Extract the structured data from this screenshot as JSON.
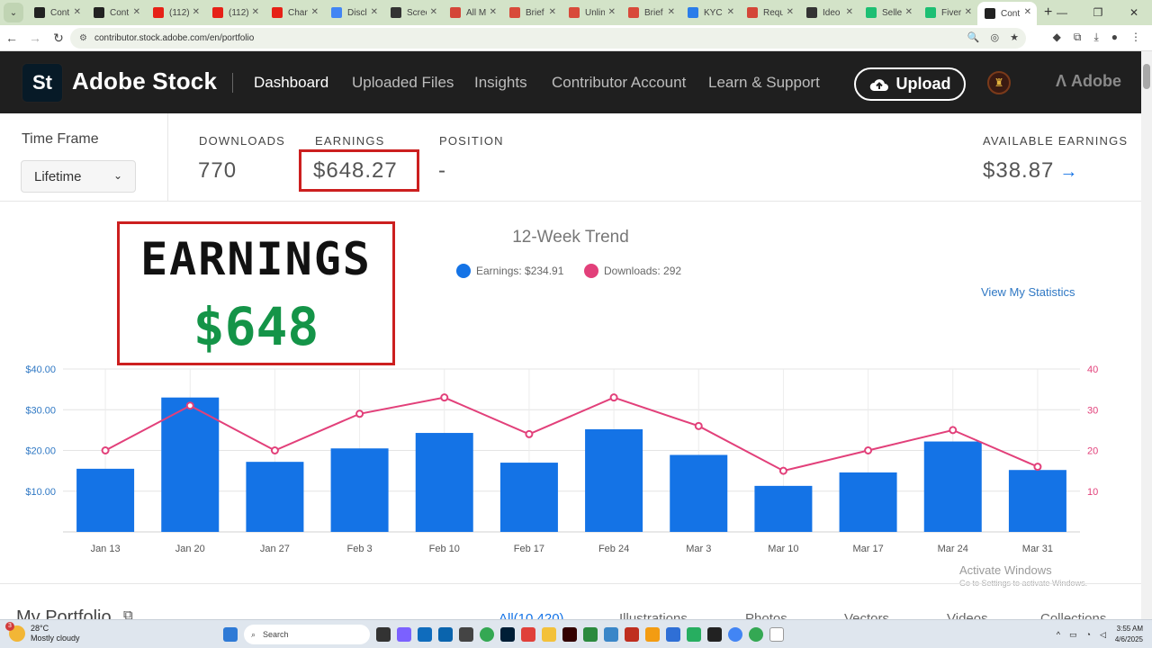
{
  "browser": {
    "tabs": [
      {
        "title": "Cont",
        "icon": "adobe-stock-icon",
        "color": "#222222"
      },
      {
        "title": "Cont",
        "icon": "adobe-stock-icon",
        "color": "#222222"
      },
      {
        "title": "(112)",
        "icon": "youtube-icon",
        "color": "#e62117"
      },
      {
        "title": "(112)",
        "icon": "youtube-icon",
        "color": "#e62117"
      },
      {
        "title": "Chan",
        "icon": "youtube-icon",
        "color": "#e62117"
      },
      {
        "title": "Discl",
        "icon": "google-icon",
        "color": "#4285f4"
      },
      {
        "title": "Scree",
        "icon": "circle-icon",
        "color": "#333333"
      },
      {
        "title": "All M",
        "icon": "gmail-icon",
        "color": "#d44638"
      },
      {
        "title": "Brief",
        "icon": "wd-icon",
        "color": "#d84a3a"
      },
      {
        "title": "Unlin",
        "icon": "wd-icon",
        "color": "#d84a3a"
      },
      {
        "title": "Brief",
        "icon": "wd-icon",
        "color": "#d84a3a"
      },
      {
        "title": "KYC",
        "icon": "check-icon",
        "color": "#2b7de9"
      },
      {
        "title": "Requ",
        "icon": "gmail-icon",
        "color": "#d44638"
      },
      {
        "title": "Ideo",
        "icon": "circle-icon",
        "color": "#333333"
      },
      {
        "title": "Selle",
        "icon": "fiverr-icon",
        "color": "#1dbf73"
      },
      {
        "title": "Fiver",
        "icon": "fiverr-icon",
        "color": "#1dbf73"
      },
      {
        "title": "Cont",
        "icon": "adobe-stock-icon",
        "color": "#222222",
        "active": true
      }
    ],
    "url": "contributor.stock.adobe.com/en/portfolio"
  },
  "header": {
    "logo": "St",
    "brand": "Adobe Stock",
    "nav": [
      "Dashboard",
      "Uploaded Files",
      "Insights",
      "Contributor Account",
      "Learn & Support"
    ],
    "upload_label": "Upload",
    "adobe_label": "Adobe"
  },
  "stats": {
    "timeframe_label": "Time Frame",
    "timeframe_value": "Lifetime",
    "downloads_label": "DOWNLOADS",
    "downloads_value": "770",
    "earnings_label": "EARNINGS",
    "earnings_value": "$648.27",
    "position_label": "POSITION",
    "position_value": "-",
    "available_label": "AVAILABLE EARNINGS",
    "available_value": "$38.87"
  },
  "overlay": {
    "title": "EARNINGS",
    "value": "$648"
  },
  "trend": {
    "title": "12-Week Trend",
    "legend_earnings": "Earnings: $234.91",
    "legend_downloads": "Downloads: 292",
    "view_stats": "View My Statistics"
  },
  "chart_data": {
    "type": "bar",
    "categories": [
      "Jan 13",
      "Jan 20",
      "Jan 27",
      "Feb 3",
      "Feb 10",
      "Feb 17",
      "Feb 24",
      "Mar 3",
      "Mar 10",
      "Mar 17",
      "Mar 24",
      "Mar 31"
    ],
    "series": [
      {
        "name": "Earnings",
        "type": "bar",
        "axis": "left",
        "color": "#1473e6",
        "values": [
          15.5,
          33,
          17.2,
          20.5,
          24.3,
          17,
          25.2,
          18.9,
          11.3,
          14.6,
          22.2,
          15.2
        ]
      },
      {
        "name": "Downloads",
        "type": "line",
        "axis": "right",
        "color": "#e2407a",
        "values": [
          20,
          31,
          20,
          29,
          33,
          24,
          33,
          26,
          15,
          20,
          25,
          16
        ]
      }
    ],
    "ylim_left": [
      0,
      40
    ],
    "ylim_right": [
      0,
      40
    ],
    "yticks_left": [
      "$10.00",
      "$20.00",
      "$30.00",
      "$40.00"
    ],
    "yticks_right": [
      "10",
      "20",
      "30",
      "40"
    ],
    "grid": true
  },
  "watermark": {
    "title": "Activate Windows",
    "sub": "Go to Settings to activate Windows."
  },
  "portfolio": {
    "title": "My Portfolio",
    "tabs": [
      "All(10,420)",
      "Illustrations",
      "Photos",
      "Vectors",
      "Videos",
      "Collections"
    ]
  },
  "taskbar": {
    "temp": "28°C",
    "condition": "Mostly cloudy",
    "weather_badge": "3",
    "search": "Search",
    "time": "3:55 AM",
    "date": "4/6/2025"
  }
}
